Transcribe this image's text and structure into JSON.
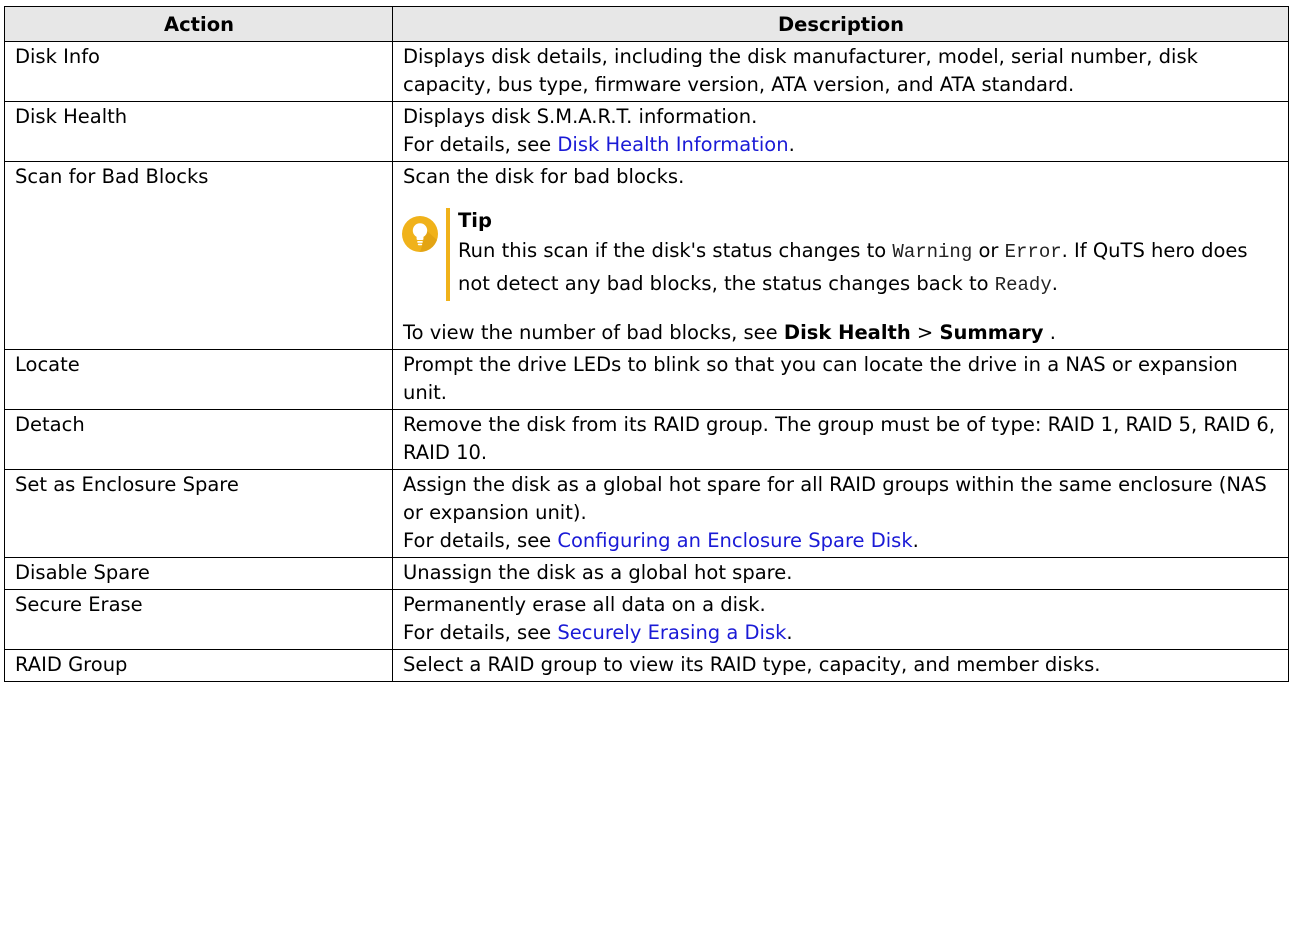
{
  "table": {
    "headers": {
      "action": "Action",
      "description": "Description"
    },
    "rows": [
      {
        "action": "Disk Info",
        "description": "Displays disk details, including the disk manufacturer, model, serial number, disk capacity, bus type, firmware version, ATA version, and ATA standard."
      },
      {
        "action": "Disk Health",
        "line1": "Displays disk S.M.A.R.T. information.",
        "details_prefix": "For details, see ",
        "link": "Disk Health Information",
        "details_suffix": "."
      },
      {
        "action": "Scan for Bad Blocks",
        "line1": "Scan the disk for bad blocks.",
        "tip": {
          "icon": "lightbulb-icon",
          "accent_color": "#f0b21a",
          "title": "Tip",
          "text_1": "Run this scan if the disk's status changes to ",
          "code_1": "Warning",
          "text_2": " or ",
          "code_2": "Error",
          "text_3": ". If QuTS hero does not detect any bad blocks, the status changes back to ",
          "code_3": "Ready",
          "text_4": "."
        },
        "after_prefix": "To view the number of bad blocks, see ",
        "after_bold_1": "Disk Health",
        "after_sep": " > ",
        "after_bold_2": "Summary",
        "after_suffix": " ."
      },
      {
        "action": "Locate",
        "description": "Prompt the drive LEDs to blink so that you can locate the drive in a NAS or expansion unit."
      },
      {
        "action": "Detach",
        "description": "Remove the disk from its RAID group. The group must be of type: RAID 1, RAID 5, RAID 6, RAID 10."
      },
      {
        "action": "Set as Enclosure Spare",
        "line1": "Assign the disk as a global hot spare for all RAID groups within the same enclosure (NAS or expansion unit).",
        "details_prefix": "For details, see ",
        "link": "Configuring an Enclosure Spare Disk",
        "details_suffix": "."
      },
      {
        "action": "Disable Spare",
        "description": "Unassign the disk as a global hot spare."
      },
      {
        "action": "Secure Erase",
        "line1": "Permanently erase all data on a disk.",
        "details_prefix": "For details, see ",
        "link": "Securely Erasing a Disk",
        "details_suffix": "."
      },
      {
        "action": "RAID Group",
        "description": "Select a RAID group to view its RAID type, capacity, and member disks."
      }
    ],
    "link_color": "#1a1ad6",
    "header_bg": "#e7e7e7"
  }
}
